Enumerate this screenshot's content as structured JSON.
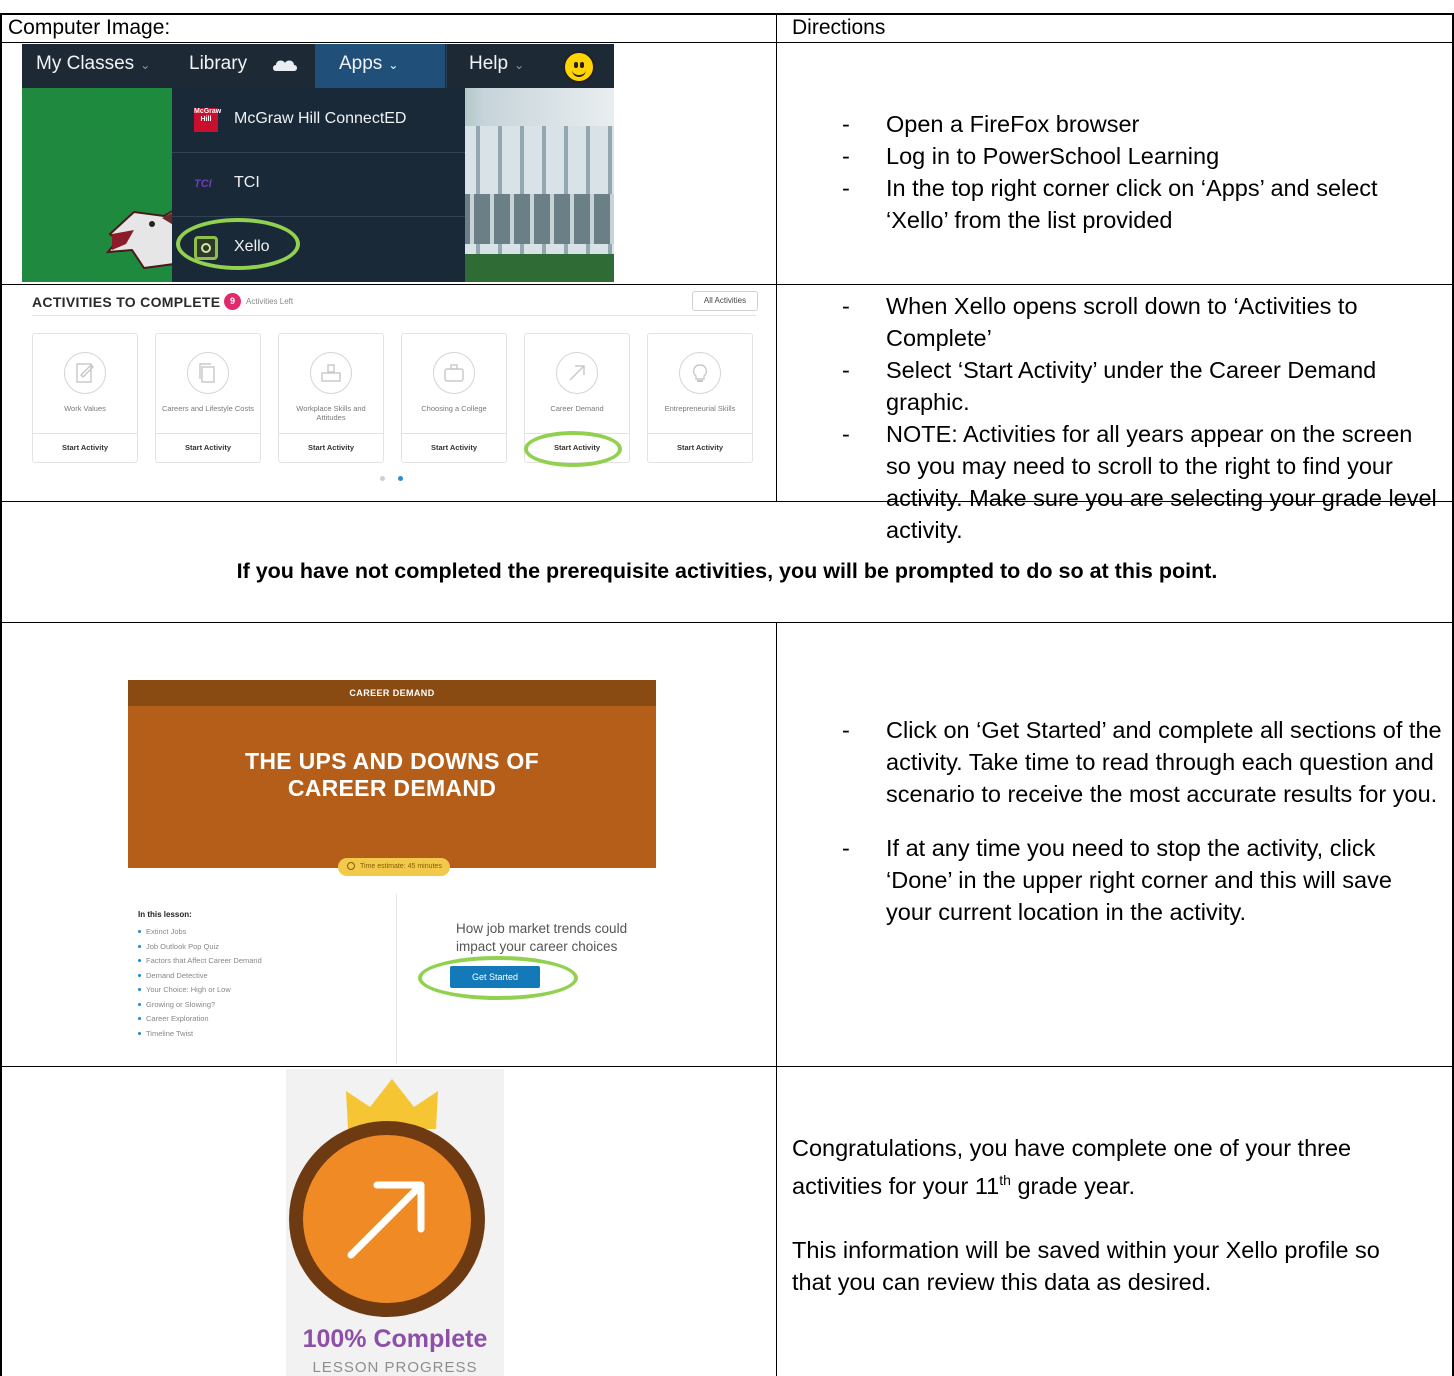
{
  "headers": {
    "computer_image": "Computer Image:",
    "directions": "Directions"
  },
  "shot_powerschool": {
    "nav": [
      "My Classes",
      "Library",
      "Apps",
      "Help"
    ],
    "apps_menu": [
      "McGraw Hill ConnectED",
      "TCI",
      "Xello"
    ],
    "mgh_logo_text": "McGraw Hill",
    "tci_logo_text": "TCI",
    "colors": {
      "nav_bg": "#1d2a36",
      "apps_active": "#20507a",
      "highlight_ring": "#92d050"
    }
  },
  "shot_activities": {
    "title": "ACTIVITIES TO COMPLETE",
    "badge_count": "9",
    "badge_suffix": "Activities Left",
    "all_button": "All Activities",
    "cards": [
      {
        "name": "Work Values",
        "action": "Start Activity",
        "icon": "edit-icon"
      },
      {
        "name": "Careers and Lifestyle Costs",
        "action": "Start Activity",
        "icon": "documents-icon"
      },
      {
        "name": "Workplace Skills and Attitudes",
        "action": "Start Activity",
        "icon": "desk-icon"
      },
      {
        "name": "Choosing a College",
        "action": "Start Activity",
        "icon": "briefcase-icon"
      },
      {
        "name": "Career Demand",
        "action": "Start Activity",
        "icon": "arrow-up-right-icon"
      },
      {
        "name": "Entrepreneurial Skills",
        "action": "Start Activity",
        "icon": "lightbulb-icon"
      }
    ]
  },
  "directions1": [
    "Open a FireFox browser",
    "Log in to PowerSchool Learning",
    "In the top right corner click on ‘Apps’ and select ‘Xello’ from the list provided"
  ],
  "directions2": [
    "When Xello opens scroll down to ‘Activities to Complete’",
    "Select ‘Start Activity’ under the Career Demand graphic.",
    "NOTE: Activities for all years appear on the screen so you may need to scroll to the right to find your activity. Make sure you are selecting your grade level activity."
  ],
  "notice": "If you have not completed the prerequisite activities, you will be prompted to do so at this point.",
  "shot_career_demand": {
    "top_bar": "CAREER DEMAND",
    "title_line1": "THE UPS AND DOWNS OF",
    "title_line2": "CAREER DEMAND",
    "time_estimate": "Time estimate: 45 minutes",
    "lesson_heading": "In this lesson:",
    "lesson_items": [
      "Extinct Jobs",
      "Job Outlook Pop Quiz",
      "Factors that Affect Career Demand",
      "Demand Detective",
      "Your Choice: High or Low",
      "Growing or Slowing?",
      "Career Exploration",
      "Timeline Twist"
    ],
    "subtitle": "How job market trends could impact your career choices",
    "button": "Get Started"
  },
  "directions3": [
    "Click on ‘Get Started’ and complete all sections of the activity. Take time to read through each question and scenario to receive the most accurate results for you.",
    "If at any time you need to stop the activity, click ‘Done’ in the upper right corner and this will save your current location in the activity."
  ],
  "shot_complete": {
    "percent": "100% Complete",
    "label": "LESSON PROGRESS",
    "colors": {
      "medal": "#f08a24",
      "rim": "#6e3a12",
      "crown": "#f6c533",
      "percent": "#8d4fa8"
    }
  },
  "directions4": {
    "para1_before": "Congratulations, you have complete one of your three activities for your 11",
    "para1_sup": "th",
    "para1_after": " grade year.",
    "para2": "This information will be saved within your Xello profile so that you can review this data as desired."
  }
}
